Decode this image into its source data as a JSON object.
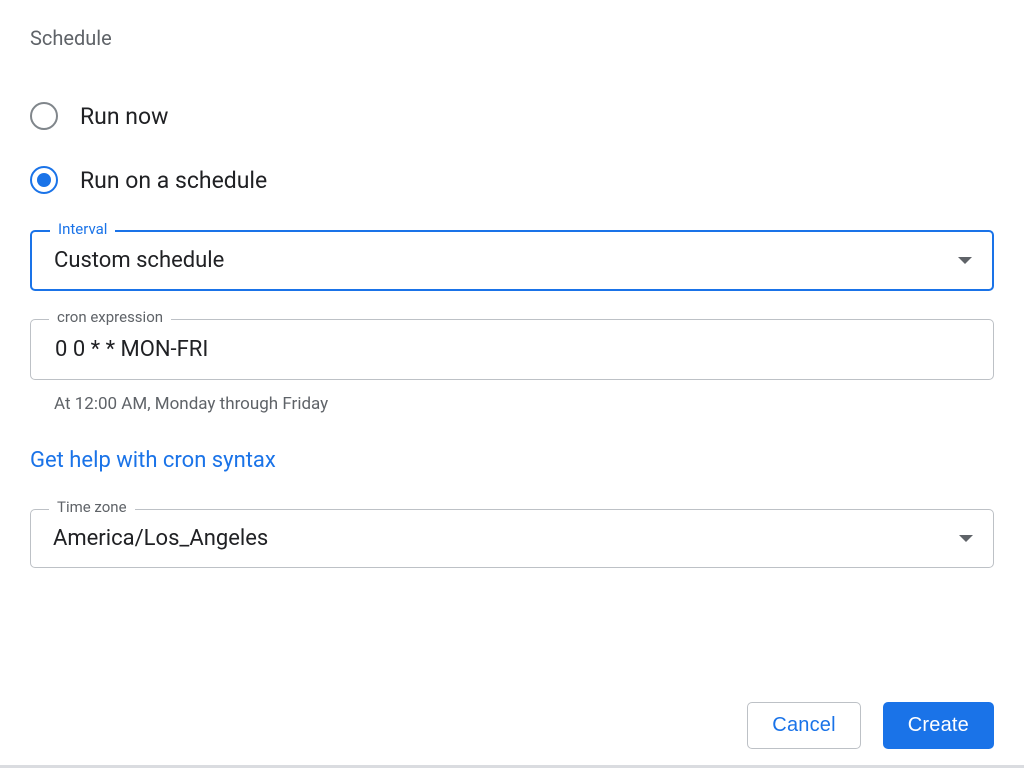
{
  "section_title": "Schedule",
  "radio": {
    "run_now": {
      "label": "Run now",
      "selected": false
    },
    "run_schedule": {
      "label": "Run on a schedule",
      "selected": true
    }
  },
  "interval": {
    "legend": "Interval",
    "value": "Custom schedule"
  },
  "cron": {
    "legend": "cron expression",
    "value": "0 0 * * MON-FRI",
    "help": "At 12:00 AM, Monday through Friday"
  },
  "help_link": "Get help with cron syntax",
  "timezone": {
    "legend": "Time zone",
    "value": "America/Los_Angeles"
  },
  "footer": {
    "cancel": "Cancel",
    "create": "Create"
  },
  "colors": {
    "primary": "#1a73e8",
    "text": "#202124",
    "muted": "#5f6368",
    "border": "#bdc1c6"
  }
}
